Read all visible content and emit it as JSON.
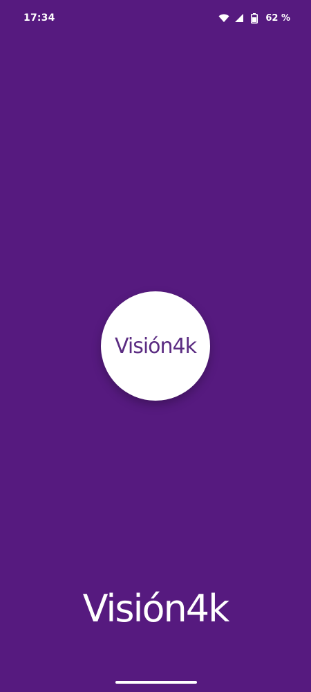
{
  "status_bar": {
    "time": "17:34",
    "icons": [
      "wifi-icon",
      "signal-icon",
      "battery-icon"
    ],
    "battery_percent": "62 %"
  },
  "splash": {
    "logo_text": "Visión4k",
    "wordmark": "Visión4k"
  },
  "colors": {
    "background": "#561A7F",
    "logo_text": "#5B2C82",
    "foreground": "#FFFFFF"
  }
}
